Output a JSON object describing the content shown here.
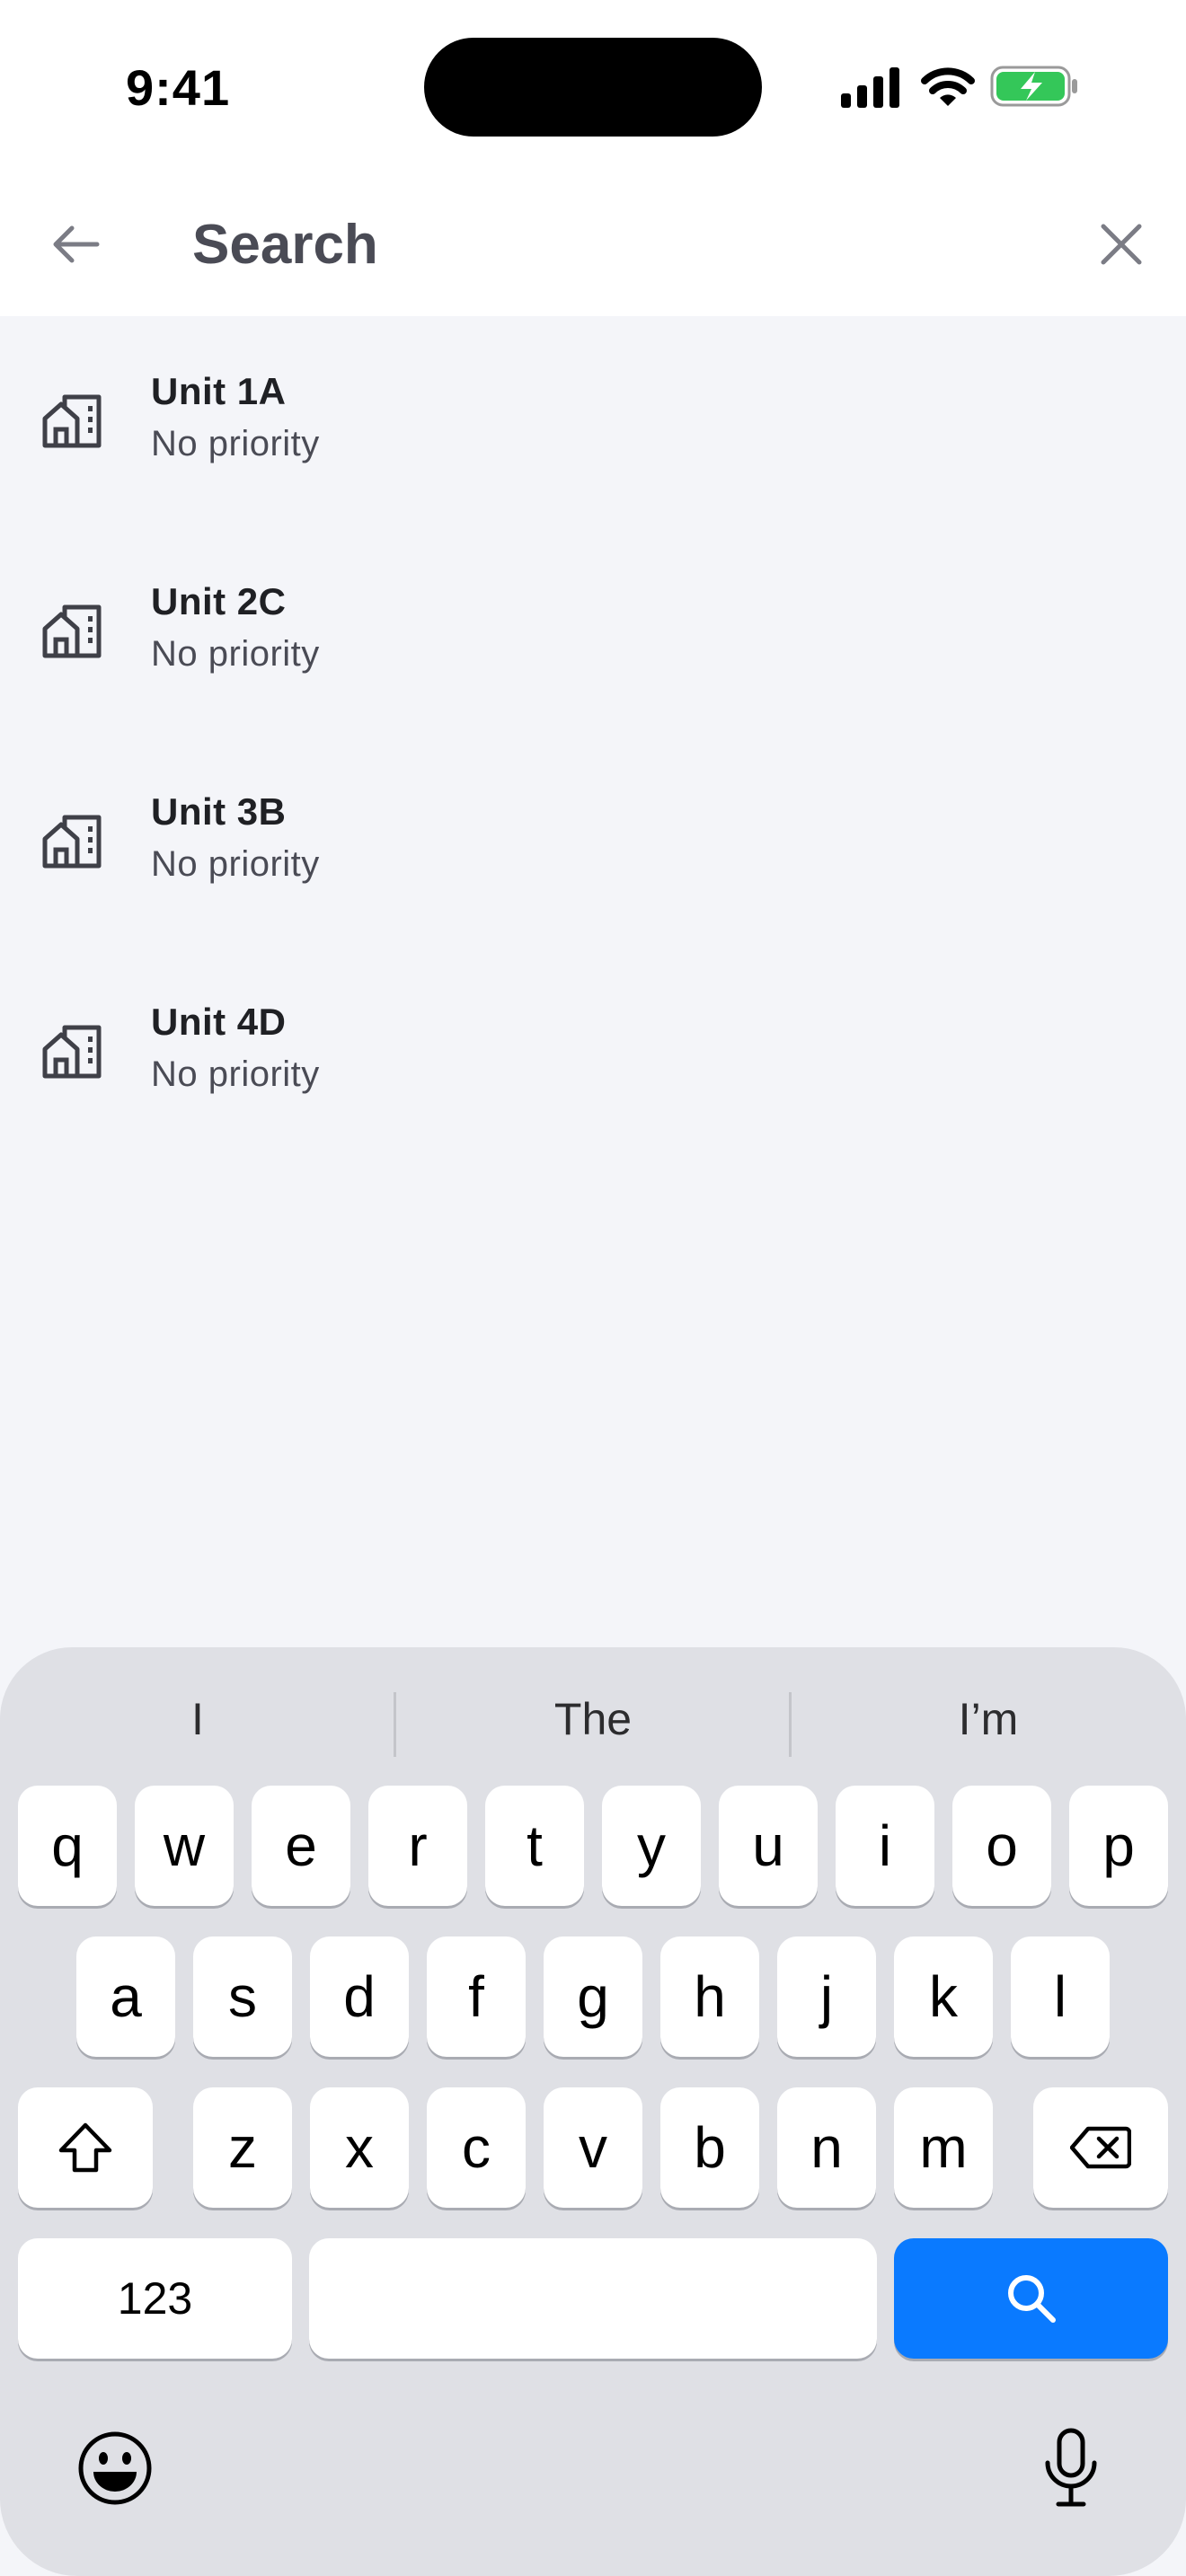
{
  "status_bar": {
    "time": "9:41"
  },
  "header": {
    "search_placeholder": "Search"
  },
  "results": [
    {
      "title": "Unit 1A",
      "subtitle": "No priority"
    },
    {
      "title": "Unit 2C",
      "subtitle": "No priority"
    },
    {
      "title": "Unit 3B",
      "subtitle": "No priority"
    },
    {
      "title": "Unit 4D",
      "subtitle": "No priority"
    }
  ],
  "keyboard": {
    "suggestions": [
      "I",
      "The",
      "I’m"
    ],
    "row1": [
      "q",
      "w",
      "e",
      "r",
      "t",
      "y",
      "u",
      "i",
      "o",
      "p"
    ],
    "row2": [
      "a",
      "s",
      "d",
      "f",
      "g",
      "h",
      "j",
      "k",
      "l"
    ],
    "row3": [
      "z",
      "x",
      "c",
      "v",
      "b",
      "n",
      "m"
    ],
    "numbers_label": "123",
    "search_key_color": "#0a7aff"
  },
  "colors": {
    "battery_fill": "#34c759",
    "background": "#f4f5f9",
    "keyboard_bg": "#dfe0e5"
  }
}
